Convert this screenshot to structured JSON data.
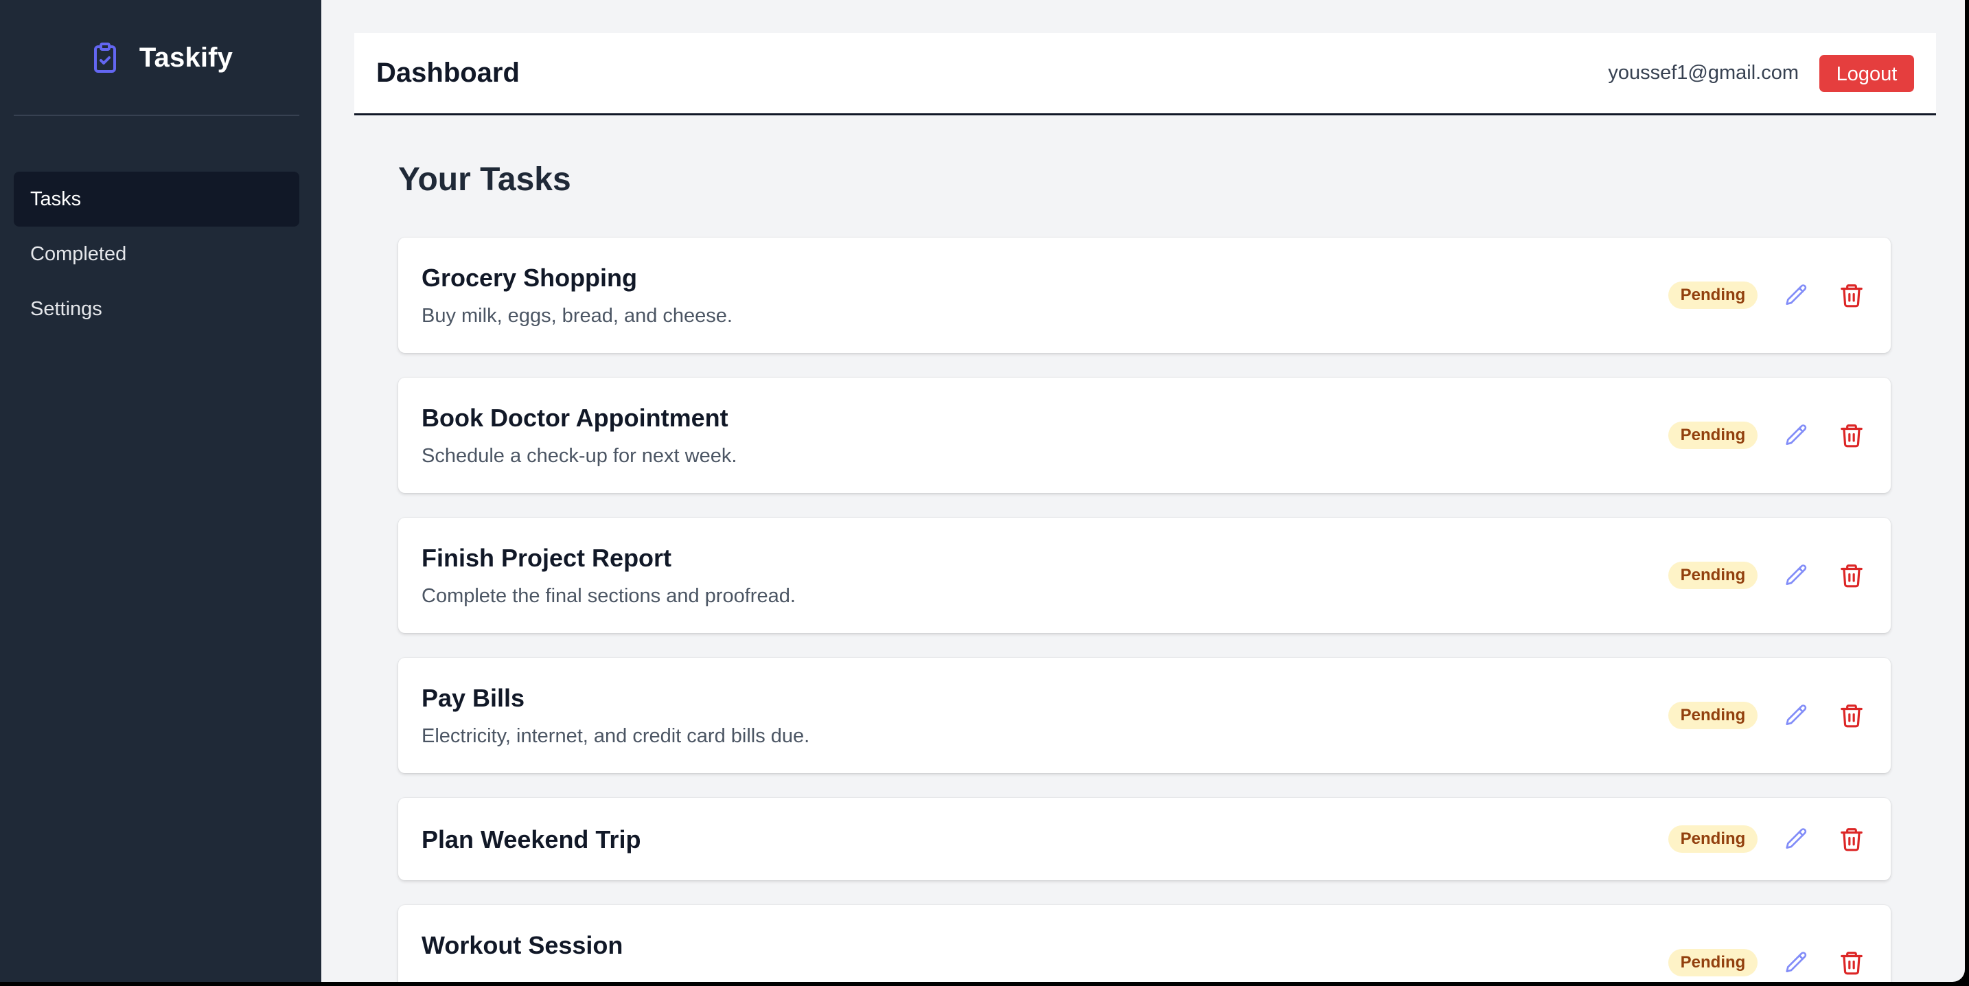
{
  "app": {
    "name": "Taskify",
    "logo_icon": "clipboard-check-icon",
    "accent_color": "#6366f1"
  },
  "sidebar": {
    "items": [
      {
        "label": "Tasks",
        "active": true
      },
      {
        "label": "Completed",
        "active": false
      },
      {
        "label": "Settings",
        "active": false
      }
    ]
  },
  "header": {
    "title": "Dashboard",
    "user_email": "youssef1@gmail.com",
    "logout_label": "Logout"
  },
  "main": {
    "heading": "Your Tasks",
    "tasks": [
      {
        "title": "Grocery Shopping",
        "description": "Buy milk, eggs, bread, and cheese.",
        "status": "Pending"
      },
      {
        "title": "Book Doctor Appointment",
        "description": "Schedule a check-up for next week.",
        "status": "Pending"
      },
      {
        "title": "Finish Project Report",
        "description": "Complete the final sections and proofread.",
        "status": "Pending"
      },
      {
        "title": "Pay Bills",
        "description": "Electricity, internet, and credit card bills due.",
        "status": "Pending"
      },
      {
        "title": "Plan Weekend Trip",
        "description": "",
        "status": "Pending"
      },
      {
        "title": "Workout Session",
        "description": "",
        "status": "Pending"
      }
    ]
  },
  "colors": {
    "sidebar_bg": "#1f2937",
    "logout_bg": "#e53e3e",
    "pending_badge_bg": "#fef3c7",
    "pending_badge_text": "#92400e",
    "edit_icon": "#818cf8",
    "delete_icon": "#dc2626"
  }
}
